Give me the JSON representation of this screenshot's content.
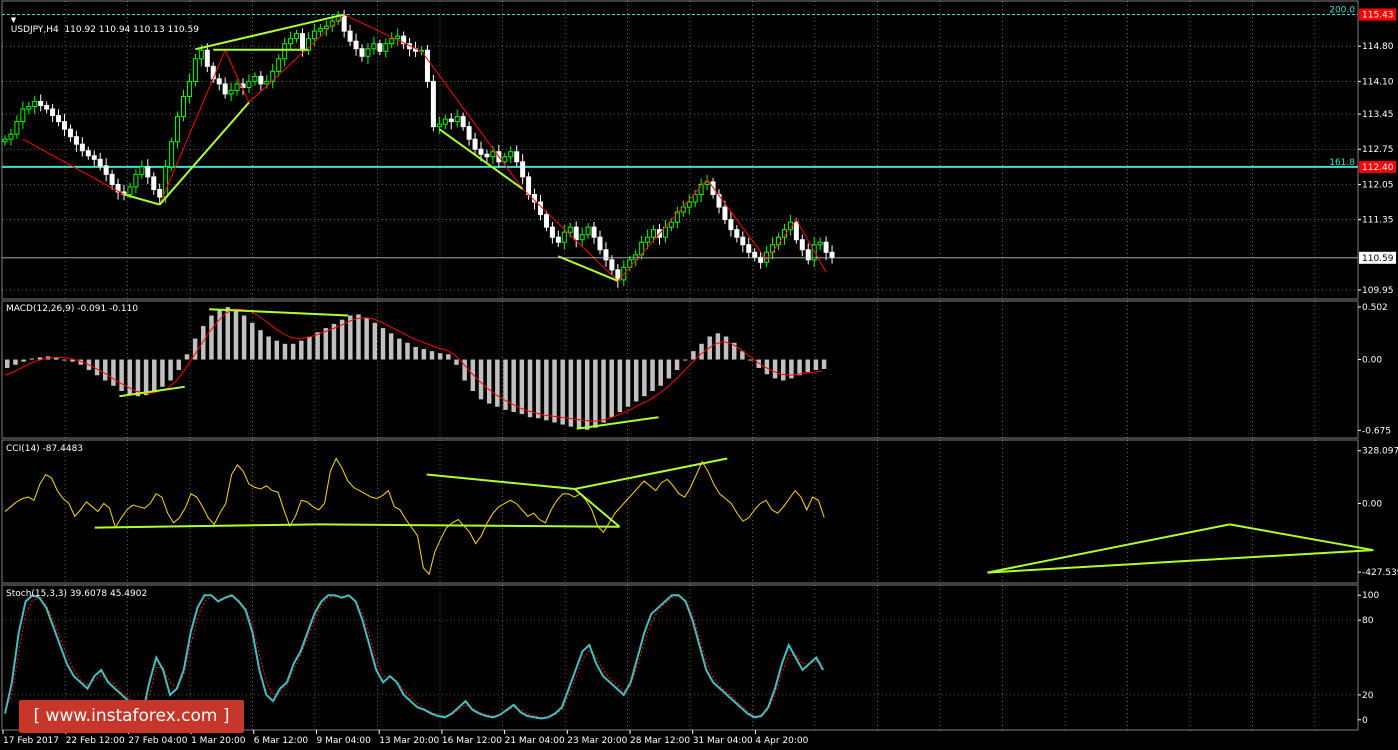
{
  "header": {
    "symbol_line": "USDJPY,H4  110.92 110.94 110.13 110.59"
  },
  "panels": {
    "macd_label": "MACD(12,26,9) -0.091 -0.110",
    "cci_label": "CCI(14) -87.4483",
    "stoch_label": "Stoch(15,3,3) 39.6078 45.4902"
  },
  "watermark": "[ www.instaforex.com ]",
  "colors": {
    "background": "#000000",
    "bull_candle": "#00ff00",
    "bear_candle": "#ffffff",
    "grid": "#ffffff",
    "fib_line": "#40e0d0",
    "trend_line": "#adff2f",
    "zigzag": "#ff0000",
    "price_tag": "#ff0000",
    "cci": "#ffd700",
    "stoch_main": "#40c0c0",
    "stoch_signal": "#ff0000",
    "macd_hist": "#c0c0c0",
    "macd_signal": "#ff0000",
    "logo_bg": "#c7362b"
  },
  "chart_data": [
    {
      "type": "candlestick",
      "title": "USDJPY,H4",
      "ohlc_last": {
        "open": 110.92,
        "high": 110.94,
        "low": 110.13,
        "close": 110.59
      },
      "x_ticks": [
        "17 Feb 2017",
        "22 Feb 12:00",
        "27 Feb 04:00",
        "1 Mar 20:00",
        "6 Mar 12:00",
        "9 Mar 04:00",
        "13 Mar 20:00",
        "16 Mar 12:00",
        "21 Mar 04:00",
        "23 Mar 20:00",
        "28 Mar 12:00",
        "31 Mar 04:00",
        "4 Apr 20:00"
      ],
      "y_ticks": [
        "114.80",
        "114.10",
        "113.45",
        "112.75",
        "112.05",
        "111.35",
        "109.95"
      ],
      "y_range": [
        109.85,
        115.62
      ],
      "levels": [
        {
          "name": "200.0",
          "value": 115.43,
          "tag": "115.43"
        },
        {
          "name": "161.8",
          "value": 112.4,
          "tag": "112.40"
        }
      ],
      "current_price": "110.59",
      "trend_segments": [
        {
          "from": [
            20,
            111.85
          ],
          "to": [
            26,
            111.65
          ]
        },
        {
          "from": [
            26,
            111.65
          ],
          "to": [
            41,
            113.68
          ]
        },
        {
          "from": [
            32,
            114.74
          ],
          "to": [
            57,
            115.43
          ]
        },
        {
          "from": [
            35,
            114.73
          ],
          "to": [
            51,
            114.73
          ]
        },
        {
          "from": [
            73,
            113.15
          ],
          "to": [
            87,
            111.96
          ]
        },
        {
          "from": [
            93,
            110.62
          ],
          "to": [
            103,
            110.13
          ]
        }
      ],
      "zigzag": [
        [
          3,
          112.95
        ],
        [
          20,
          111.85
        ],
        [
          26,
          111.65
        ],
        [
          37,
          114.72
        ],
        [
          41,
          113.68
        ],
        [
          57,
          115.43
        ],
        [
          70,
          114.7
        ],
        [
          87,
          111.96
        ],
        [
          103,
          110.13
        ],
        [
          118,
          112.15
        ],
        [
          128,
          110.55
        ],
        [
          133,
          111.35
        ],
        [
          138,
          110.3
        ]
      ],
      "series_close": [
        112.95,
        113.05,
        113.3,
        113.55,
        113.6,
        113.7,
        113.62,
        113.55,
        113.42,
        113.3,
        113.15,
        113.0,
        112.85,
        112.72,
        112.62,
        112.55,
        112.42,
        112.25,
        112.05,
        111.9,
        111.85,
        112.0,
        112.25,
        112.4,
        112.2,
        111.95,
        111.8,
        112.4,
        112.9,
        113.4,
        113.8,
        114.1,
        114.55,
        114.72,
        114.4,
        114.15,
        114.05,
        113.85,
        113.92,
        114.05,
        113.98,
        114.1,
        114.2,
        114.05,
        114.1,
        114.3,
        114.55,
        114.85,
        114.95,
        115.05,
        114.72,
        114.95,
        115.1,
        115.15,
        115.2,
        115.3,
        115.42,
        115.1,
        114.9,
        114.75,
        114.6,
        114.75,
        114.85,
        114.7,
        114.85,
        114.95,
        115.0,
        114.85,
        114.75,
        114.7,
        114.72,
        114.1,
        113.2,
        113.25,
        113.35,
        113.3,
        113.4,
        113.2,
        112.95,
        112.75,
        112.65,
        112.6,
        112.7,
        112.5,
        112.6,
        112.7,
        112.5,
        112.2,
        111.85,
        111.7,
        111.45,
        111.2,
        111.0,
        110.9,
        111.1,
        111.2,
        110.95,
        111.05,
        111.2,
        111.0,
        110.75,
        110.55,
        110.35,
        110.15,
        110.4,
        110.55,
        110.65,
        110.9,
        111.0,
        111.15,
        111.0,
        111.2,
        111.3,
        111.5,
        111.6,
        111.7,
        111.85,
        112.05,
        112.1,
        111.85,
        111.6,
        111.35,
        111.15,
        111.0,
        110.85,
        110.7,
        110.6,
        110.5,
        110.7,
        110.85,
        111.0,
        111.15,
        111.3,
        110.95,
        110.75,
        110.55,
        110.85,
        110.9,
        110.7,
        110.59
      ]
    },
    {
      "type": "bar",
      "title": "MACD(12,26,9)",
      "y_ticks": [
        "0.502",
        "0.00",
        "-0.675"
      ],
      "y_range": [
        -0.71,
        0.52
      ],
      "values_last": {
        "main": -0.091,
        "signal": -0.11
      },
      "histogram": [
        -0.08,
        -0.05,
        -0.02,
        0.01,
        0.02,
        0.03,
        0.02,
        0.0,
        -0.02,
        -0.05,
        -0.1,
        -0.15,
        -0.2,
        -0.25,
        -0.3,
        -0.33,
        -0.35,
        -0.34,
        -0.3,
        -0.26,
        -0.2,
        -0.1,
        0.05,
        0.2,
        0.32,
        0.42,
        0.48,
        0.5,
        0.46,
        0.42,
        0.35,
        0.28,
        0.22,
        0.18,
        0.15,
        0.15,
        0.18,
        0.22,
        0.26,
        0.3,
        0.34,
        0.38,
        0.42,
        0.43,
        0.4,
        0.35,
        0.3,
        0.25,
        0.2,
        0.16,
        0.12,
        0.1,
        0.08,
        0.06,
        0.05,
        -0.05,
        -0.2,
        -0.3,
        -0.38,
        -0.42,
        -0.45,
        -0.48,
        -0.5,
        -0.52,
        -0.55,
        -0.56,
        -0.58,
        -0.6,
        -0.62,
        -0.64,
        -0.66,
        -0.67,
        -0.65,
        -0.6,
        -0.55,
        -0.5,
        -0.45,
        -0.4,
        -0.35,
        -0.3,
        -0.25,
        -0.18,
        -0.1,
        0.0,
        0.08,
        0.15,
        0.22,
        0.25,
        0.22,
        0.16,
        0.08,
        0.0,
        -0.08,
        -0.14,
        -0.18,
        -0.2,
        -0.18,
        -0.15,
        -0.12,
        -0.1,
        -0.09
      ],
      "signal": [
        -0.15,
        -0.12,
        -0.08,
        -0.04,
        -0.01,
        0.01,
        0.02,
        0.02,
        0.01,
        -0.01,
        -0.04,
        -0.08,
        -0.12,
        -0.17,
        -0.22,
        -0.26,
        -0.3,
        -0.32,
        -0.32,
        -0.3,
        -0.27,
        -0.2,
        -0.1,
        0.02,
        0.14,
        0.26,
        0.36,
        0.44,
        0.48,
        0.48,
        0.46,
        0.42,
        0.36,
        0.3,
        0.25,
        0.21,
        0.2,
        0.21,
        0.23,
        0.26,
        0.29,
        0.32,
        0.36,
        0.39,
        0.4,
        0.39,
        0.36,
        0.32,
        0.28,
        0.24,
        0.2,
        0.17,
        0.14,
        0.11,
        0.09,
        0.05,
        -0.03,
        -0.12,
        -0.2,
        -0.27,
        -0.33,
        -0.38,
        -0.42,
        -0.46,
        -0.49,
        -0.51,
        -0.53,
        -0.54,
        -0.55,
        -0.56,
        -0.57,
        -0.58,
        -0.59,
        -0.58,
        -0.56,
        -0.53,
        -0.5,
        -0.46,
        -0.42,
        -0.38,
        -0.33,
        -0.27,
        -0.2,
        -0.12,
        -0.04,
        0.04,
        0.1,
        0.15,
        0.17,
        0.15,
        0.1,
        0.04,
        -0.02,
        -0.07,
        -0.11,
        -0.14,
        -0.15,
        -0.14,
        -0.13,
        -0.12,
        -0.11
      ],
      "trend_segments": [
        {
          "from": [
            14,
            -0.35
          ],
          "to": [
            22,
            -0.26
          ]
        },
        {
          "from": [
            25,
            0.48
          ],
          "to": [
            42,
            0.42
          ]
        },
        {
          "from": [
            70,
            -0.66
          ],
          "to": [
            80,
            -0.55
          ]
        }
      ]
    },
    {
      "type": "line",
      "title": "CCI(14)",
      "y_ticks": [
        "328.0971",
        "0.00",
        "-427.539"
      ],
      "y_range": [
        -470,
        370
      ],
      "value_last": -87.4483,
      "values": [
        -50,
        -20,
        10,
        30,
        40,
        20,
        120,
        180,
        160,
        80,
        30,
        0,
        -80,
        -40,
        10,
        -20,
        -50,
        0,
        -30,
        -150,
        -90,
        -40,
        -10,
        -20,
        -30,
        0,
        60,
        40,
        -60,
        -120,
        -90,
        -30,
        60,
        40,
        -20,
        -90,
        -130,
        -60,
        0,
        180,
        240,
        200,
        120,
        100,
        90,
        110,
        80,
        70,
        -40,
        -140,
        -80,
        20,
        10,
        -20,
        -40,
        0,
        200,
        280,
        220,
        140,
        100,
        80,
        60,
        40,
        30,
        50,
        80,
        -20,
        -40,
        -100,
        -150,
        -200,
        -400,
        -440,
        -300,
        -220,
        -150,
        -120,
        -100,
        -140,
        -180,
        -250,
        -200,
        -120,
        -60,
        -20,
        0,
        20,
        0,
        -40,
        -80,
        -60,
        -100,
        -120,
        -40,
        20,
        60,
        60,
        40,
        60,
        20,
        -40,
        -140,
        -180,
        -120,
        -60,
        -20,
        20,
        60,
        100,
        140,
        110,
        80,
        130,
        150,
        110,
        60,
        40,
        100,
        180,
        260,
        200,
        120,
        60,
        30,
        0,
        -60,
        -110,
        -90,
        -40,
        0,
        20,
        -40,
        -60,
        -20,
        30,
        80,
        40,
        -40,
        40,
        20,
        -87
      ]
    },
    {
      "type": "line",
      "title": "Stoch(15,3,3)",
      "y_ticks": [
        "100",
        "80",
        "20",
        "0"
      ],
      "y_range": [
        -5,
        105
      ],
      "values_last": {
        "main": 39.6078,
        "signal": 45.4902
      },
      "main": [
        5,
        30,
        70,
        95,
        100,
        98,
        90,
        75,
        60,
        45,
        35,
        30,
        25,
        35,
        40,
        30,
        25,
        20,
        15,
        10,
        5,
        30,
        50,
        40,
        20,
        25,
        40,
        70,
        90,
        100,
        100,
        95,
        98,
        100,
        95,
        88,
        70,
        40,
        20,
        15,
        25,
        30,
        45,
        55,
        70,
        85,
        95,
        100,
        100,
        98,
        100,
        95,
        80,
        60,
        40,
        30,
        35,
        30,
        20,
        15,
        10,
        8,
        5,
        3,
        2,
        5,
        10,
        15,
        8,
        5,
        3,
        2,
        4,
        8,
        12,
        6,
        3,
        2,
        1,
        2,
        5,
        10,
        25,
        40,
        55,
        60,
        45,
        35,
        30,
        25,
        20,
        30,
        50,
        70,
        85,
        90,
        95,
        100,
        100,
        95,
        80,
        60,
        40,
        30,
        25,
        20,
        15,
        10,
        5,
        2,
        3,
        10,
        25,
        45,
        60,
        50,
        40,
        45,
        50,
        40
      ],
      "signal": [
        8,
        20,
        55,
        85,
        96,
        97,
        92,
        80,
        66,
        52,
        40,
        32,
        28,
        32,
        36,
        32,
        28,
        22,
        18,
        12,
        8,
        20,
        42,
        42,
        30,
        26,
        36,
        60,
        82,
        95,
        99,
        97,
        97,
        99,
        96,
        90,
        76,
        52,
        30,
        20,
        22,
        28,
        40,
        52,
        66,
        80,
        92,
        98,
        99,
        99,
        99,
        96,
        85,
        68,
        48,
        35,
        34,
        31,
        24,
        18,
        13,
        9,
        6,
        4,
        3,
        4,
        8,
        12,
        9,
        6,
        4,
        3,
        4,
        7,
        10,
        8,
        5,
        3,
        2,
        2,
        4,
        8,
        20,
        34,
        48,
        56,
        50,
        40,
        33,
        28,
        23,
        27,
        44,
        62,
        78,
        88,
        93,
        98,
        99,
        96,
        84,
        66,
        46,
        34,
        27,
        22,
        17,
        12,
        7,
        3,
        3,
        8,
        20,
        38,
        52,
        52,
        45,
        45,
        47,
        45
      ]
    }
  ]
}
